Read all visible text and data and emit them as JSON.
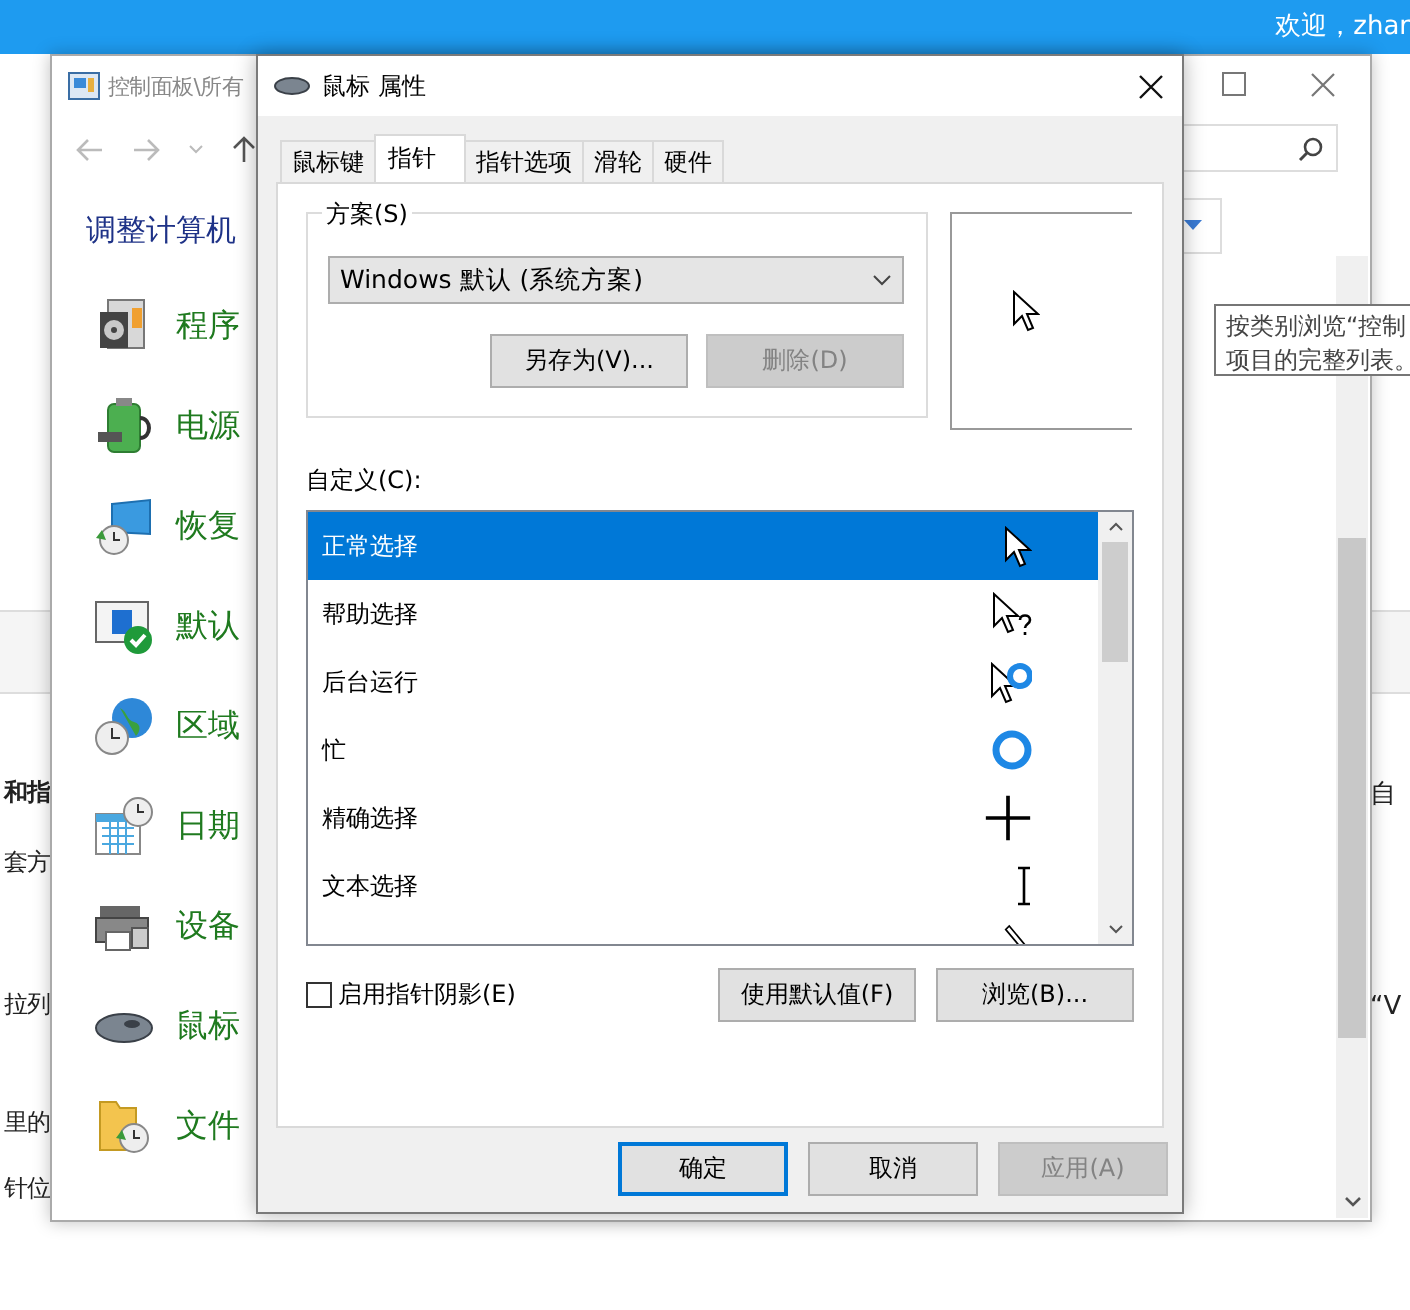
{
  "web_page": {
    "welcome": "欢迎，zhar",
    "left_fragments": [
      {
        "text": "和指",
        "bold": true
      },
      {
        "text": "套方",
        "bold": false
      },
      {
        "text": "拉列",
        "bold": false
      },
      {
        "text": "里的",
        "bold": false
      },
      {
        "text": "针位",
        "bold": false
      }
    ],
    "right_fragments": [
      "自",
      "“V"
    ]
  },
  "control_panel": {
    "title": "控制面板\\所有",
    "heading": "调整计算机",
    "tooltip": [
      "按类别浏览“控制",
      "项目的完整列表。"
    ],
    "items": [
      {
        "kind": "programs",
        "label": "程序"
      },
      {
        "kind": "power",
        "label": "电源"
      },
      {
        "kind": "recovery",
        "label": "恢复"
      },
      {
        "kind": "defaults",
        "label": "默认"
      },
      {
        "kind": "region",
        "label": "区域"
      },
      {
        "kind": "datetime",
        "label": "日期"
      },
      {
        "kind": "devices",
        "label": "设备"
      },
      {
        "kind": "mouse",
        "label": "鼠标"
      },
      {
        "kind": "history",
        "label": "文件"
      }
    ]
  },
  "dialog": {
    "title": "鼠标 属性",
    "tabs": [
      {
        "label": "鼠标键",
        "selected": false
      },
      {
        "label": "指针",
        "selected": true
      },
      {
        "label": "指针选项",
        "selected": false
      },
      {
        "label": "滑轮",
        "selected": false
      },
      {
        "label": "硬件",
        "selected": false
      }
    ],
    "scheme": {
      "label": "方案(S)",
      "value": "Windows 默认 (系统方案)",
      "buttons": [
        {
          "label": "另存为(V)...",
          "disabled": false
        },
        {
          "label": "删除(D)",
          "disabled": true
        }
      ]
    },
    "customize_label": "自定义(C):",
    "cursors": [
      {
        "kind": "normal",
        "label": "正常选择",
        "selected": true
      },
      {
        "kind": "help",
        "label": "帮助选择",
        "selected": false
      },
      {
        "kind": "working",
        "label": "后台运行",
        "selected": false
      },
      {
        "kind": "busy",
        "label": "忙",
        "selected": false
      },
      {
        "kind": "cross",
        "label": "精确选择",
        "selected": false
      },
      {
        "kind": "text",
        "label": "文本选择",
        "selected": false
      },
      {
        "kind": "pen",
        "selected": false
      }
    ],
    "shadow": {
      "label": "启用指针阴影(E)",
      "checked": false
    },
    "list_buttons": [
      "使用默认值(F)",
      "浏览(B)..."
    ],
    "footer_buttons": [
      {
        "label": "确定",
        "default": true,
        "disabled": false
      },
      {
        "label": "取消",
        "default": false,
        "disabled": false
      },
      {
        "label": "应用(A)",
        "default": false,
        "disabled": true
      }
    ]
  }
}
